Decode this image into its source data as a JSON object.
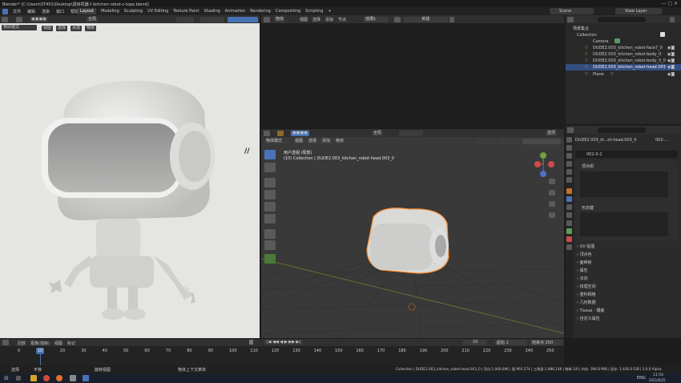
{
  "window": {
    "title": "Blender* [C:\\Users\\ST401\\Desktop\\厨房机器人\\kitchen robot-c-topo.blend]"
  },
  "menubar": {
    "items": [
      "文件",
      "编辑",
      "渲染",
      "窗口",
      "帮助"
    ],
    "workspaces": [
      "Layout",
      "Modeling",
      "Sculpting",
      "UV Editing",
      "Texture Paint",
      "Shading",
      "Animation",
      "Rendering",
      "Compositing",
      "Scripting"
    ],
    "scene": "Scene",
    "view_layer": "View Layer"
  },
  "left_viewport": {
    "mode": "物体模式",
    "menus": [
      "视图",
      "选择",
      "添加",
      "物体"
    ],
    "global": "全局"
  },
  "node_editor": {
    "menus": [
      "视图",
      "选择",
      "添加",
      "节点"
    ],
    "slot": "插槽1",
    "new_button": "新建",
    "object": "物体"
  },
  "main_viewport": {
    "mode": "物体模式",
    "menus": [
      "视图",
      "选择",
      "添加",
      "物体"
    ],
    "global": "全局",
    "option": "选项",
    "overlay_line1": "用户透视 (局部)",
    "overlay_line2": "(10) Collection | DUDE2.003_kitchen_robot-head.003_0"
  },
  "outliner": {
    "root": "场景集合",
    "collection": "Collection",
    "items": [
      "Camera",
      "DUDE2.003_kitchen_robot-face7_0",
      "DUDE2.003_kitchen_robot-body_0",
      "DUDE2.003_kitchen_robot-body_0_0",
      "DUDE2.003_kitchen_robot-head.003",
      "Plane"
    ]
  },
  "properties": {
    "object_name": "DUDE2.003_ki...ot-head.003_0",
    "mesh_short": "002-...",
    "mesh_name": "002-0-2",
    "vertex_groups": "顶点组",
    "shape_keys": "形态键",
    "sections": [
      "UV 贴图",
      "顶点色",
      "面映射",
      "属性",
      "法向",
      "纹理空间",
      "重构网格",
      "几何数据",
      "Tissue - 镶嵌",
      "自定义属性"
    ]
  },
  "timeline": {
    "menus": [
      "回放",
      "抠像(插帧)",
      "视图",
      "标记"
    ],
    "current_frame": "10",
    "start_label": "起始",
    "start": "1",
    "end_label": "结束点",
    "end": "250",
    "ticks": [
      "0",
      "10",
      "20",
      "30",
      "40",
      "50",
      "60",
      "70",
      "80",
      "90",
      "100",
      "110",
      "120",
      "130",
      "140",
      "150",
      "160",
      "170",
      "180",
      "190",
      "200",
      "210",
      "220",
      "230",
      "240",
      "250"
    ]
  },
  "statusbar": {
    "left1": "选择",
    "left2": "平移",
    "mid1": "旋转视图",
    "mid2": "物体上下文菜单",
    "right": "Collection | DUDE2.003_kitchen_robot-head.003_0 | 顶点:1,000,696 | 面:993,574 | 三角面:1,986,148 | 物体:1/6 | 内存: 394.8 MiB | 显存: 1,426.0 GiB | 3.0.0 Alpha"
  },
  "taskbar": {
    "time": "11:54",
    "date": "2021/6/25",
    "lang": "ENG"
  },
  "colors": {
    "accent": "#4772b3",
    "selection": "#ff8c2a",
    "grid": "#353535"
  }
}
